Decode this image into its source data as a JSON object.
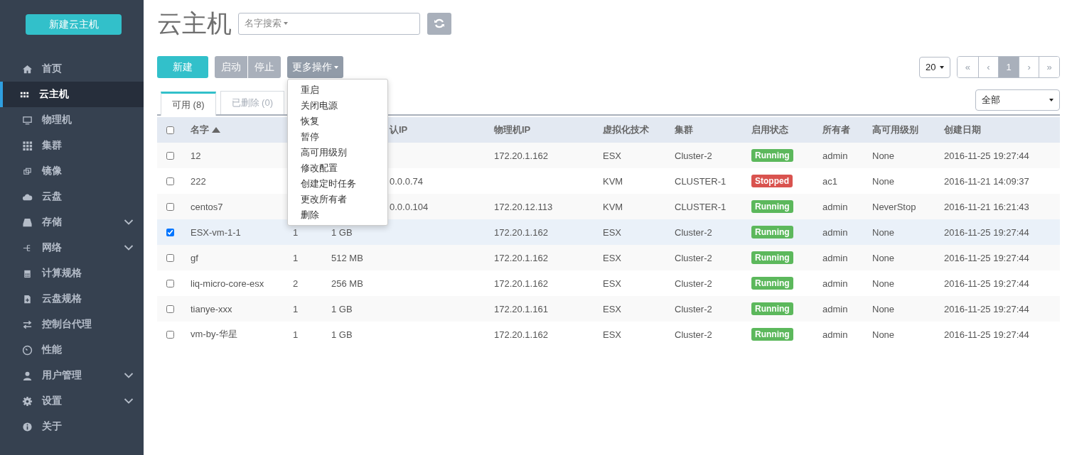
{
  "sidebar": {
    "new_button": "新建云主机",
    "items": [
      {
        "label": "首页",
        "selected": false,
        "expandable": false
      },
      {
        "label": "云主机",
        "selected": true,
        "expandable": false
      },
      {
        "label": "物理机",
        "selected": false,
        "expandable": false
      },
      {
        "label": "集群",
        "selected": false,
        "expandable": false
      },
      {
        "label": "镜像",
        "selected": false,
        "expandable": false
      },
      {
        "label": "云盘",
        "selected": false,
        "expandable": false
      },
      {
        "label": "存储",
        "selected": false,
        "expandable": true
      },
      {
        "label": "网络",
        "selected": false,
        "expandable": true
      },
      {
        "label": "计算规格",
        "selected": false,
        "expandable": false
      },
      {
        "label": "云盘规格",
        "selected": false,
        "expandable": false
      },
      {
        "label": "控制台代理",
        "selected": false,
        "expandable": false
      },
      {
        "label": "性能",
        "selected": false,
        "expandable": false
      },
      {
        "label": "用户管理",
        "selected": false,
        "expandable": true
      },
      {
        "label": "设置",
        "selected": false,
        "expandable": true
      },
      {
        "label": "关于",
        "selected": false,
        "expandable": false
      }
    ]
  },
  "page_title": "云主机",
  "search": {
    "filter": "名字搜索"
  },
  "toolbar": {
    "new": "新建",
    "start": "启动",
    "stop": "停止",
    "more": "更多操作"
  },
  "more_menu": [
    "重启",
    "关闭电源",
    "恢复",
    "暂停",
    "高可用级别",
    "修改配置",
    "创建定时任务",
    "更改所有者",
    "删除"
  ],
  "page_size": "20",
  "pagination": [
    {
      "label": "«",
      "selected": false
    },
    {
      "label": "‹",
      "selected": false
    },
    {
      "label": "1",
      "selected": true
    },
    {
      "label": "›",
      "selected": false
    },
    {
      "label": "»",
      "selected": false
    }
  ],
  "tabs": [
    {
      "label": "可用 (8)",
      "selected": true
    },
    {
      "label": "已删除 (0)",
      "selected": false
    }
  ],
  "filter_select": "全部",
  "table": {
    "select_all_checked": false,
    "columns": [
      {
        "label": "名字",
        "sort_ascending": true
      },
      {},
      {},
      {
        "label": "认IP"
      },
      {
        "label": "物理机IP"
      },
      {
        "label": "虚拟化技术"
      },
      {
        "label": "集群"
      },
      {
        "label": "启用状态"
      },
      {
        "label": "所有者"
      },
      {
        "label": "高可用级别"
      },
      {
        "label": "创建日期"
      }
    ],
    "rows": [
      {
        "selected": false,
        "name": "12",
        "physical_ip": "172.20.1.162",
        "hypervisor": "ESX",
        "cluster": "Cluster-2",
        "state": "Running",
        "color": "#5cb85c",
        "owner": "admin",
        "ha_level": "None",
        "created": "2016-11-25 19:27:44"
      },
      {
        "selected": false,
        "name": "222",
        "column_4": "0.0.0.74",
        "hypervisor": "KVM",
        "cluster": "CLUSTER-1",
        "state": "Stopped",
        "color": "#d9534f",
        "owner": "ac1",
        "ha_level": "None",
        "created": "2016-11-21 14:09:37"
      },
      {
        "selected": false,
        "name": "centos7",
        "column_4": "0.0.0.104",
        "physical_ip": "172.20.12.113",
        "hypervisor": "KVM",
        "cluster": "CLUSTER-1",
        "state": "Running",
        "color": "#5cb85c",
        "owner": "admin",
        "ha_level": "NeverStop",
        "created": "2016-11-21 16:21:43"
      },
      {
        "selected": true,
        "name": "ESX-vm-1-1",
        "column_2": "1",
        "column_3": "1 GB",
        "physical_ip": "172.20.1.162",
        "hypervisor": "ESX",
        "cluster": "Cluster-2",
        "state": "Running",
        "color": "#5cb85c",
        "owner": "admin",
        "ha_level": "None",
        "created": "2016-11-25 19:27:44"
      },
      {
        "selected": false,
        "name": "gf",
        "column_2": "1",
        "column_3": "512 MB",
        "physical_ip": "172.20.1.162",
        "hypervisor": "ESX",
        "cluster": "Cluster-2",
        "state": "Running",
        "color": "#5cb85c",
        "owner": "admin",
        "ha_level": "None",
        "created": "2016-11-25 19:27:44"
      },
      {
        "selected": false,
        "name": "liq-micro-core-esx",
        "column_2": "2",
        "column_3": "256 MB",
        "physical_ip": "172.20.1.162",
        "hypervisor": "ESX",
        "cluster": "Cluster-2",
        "state": "Running",
        "color": "#5cb85c",
        "owner": "admin",
        "ha_level": "None",
        "created": "2016-11-25 19:27:44"
      },
      {
        "selected": false,
        "name": "tianye-xxx",
        "column_2": "1",
        "column_3": "1 GB",
        "physical_ip": "172.20.1.161",
        "hypervisor": "ESX",
        "cluster": "Cluster-2",
        "state": "Running",
        "color": "#5cb85c",
        "owner": "admin",
        "ha_level": "None",
        "created": "2016-11-25 19:27:44"
      },
      {
        "selected": false,
        "name": "vm-by-华星",
        "column_2": "1",
        "column_3": "1 GB",
        "physical_ip": "172.20.1.162",
        "hypervisor": "ESX",
        "cluster": "Cluster-2",
        "state": "Running",
        "color": "#5cb85c",
        "owner": "admin",
        "ha_level": "None",
        "created": "2016-11-25 19:27:44"
      }
    ]
  }
}
